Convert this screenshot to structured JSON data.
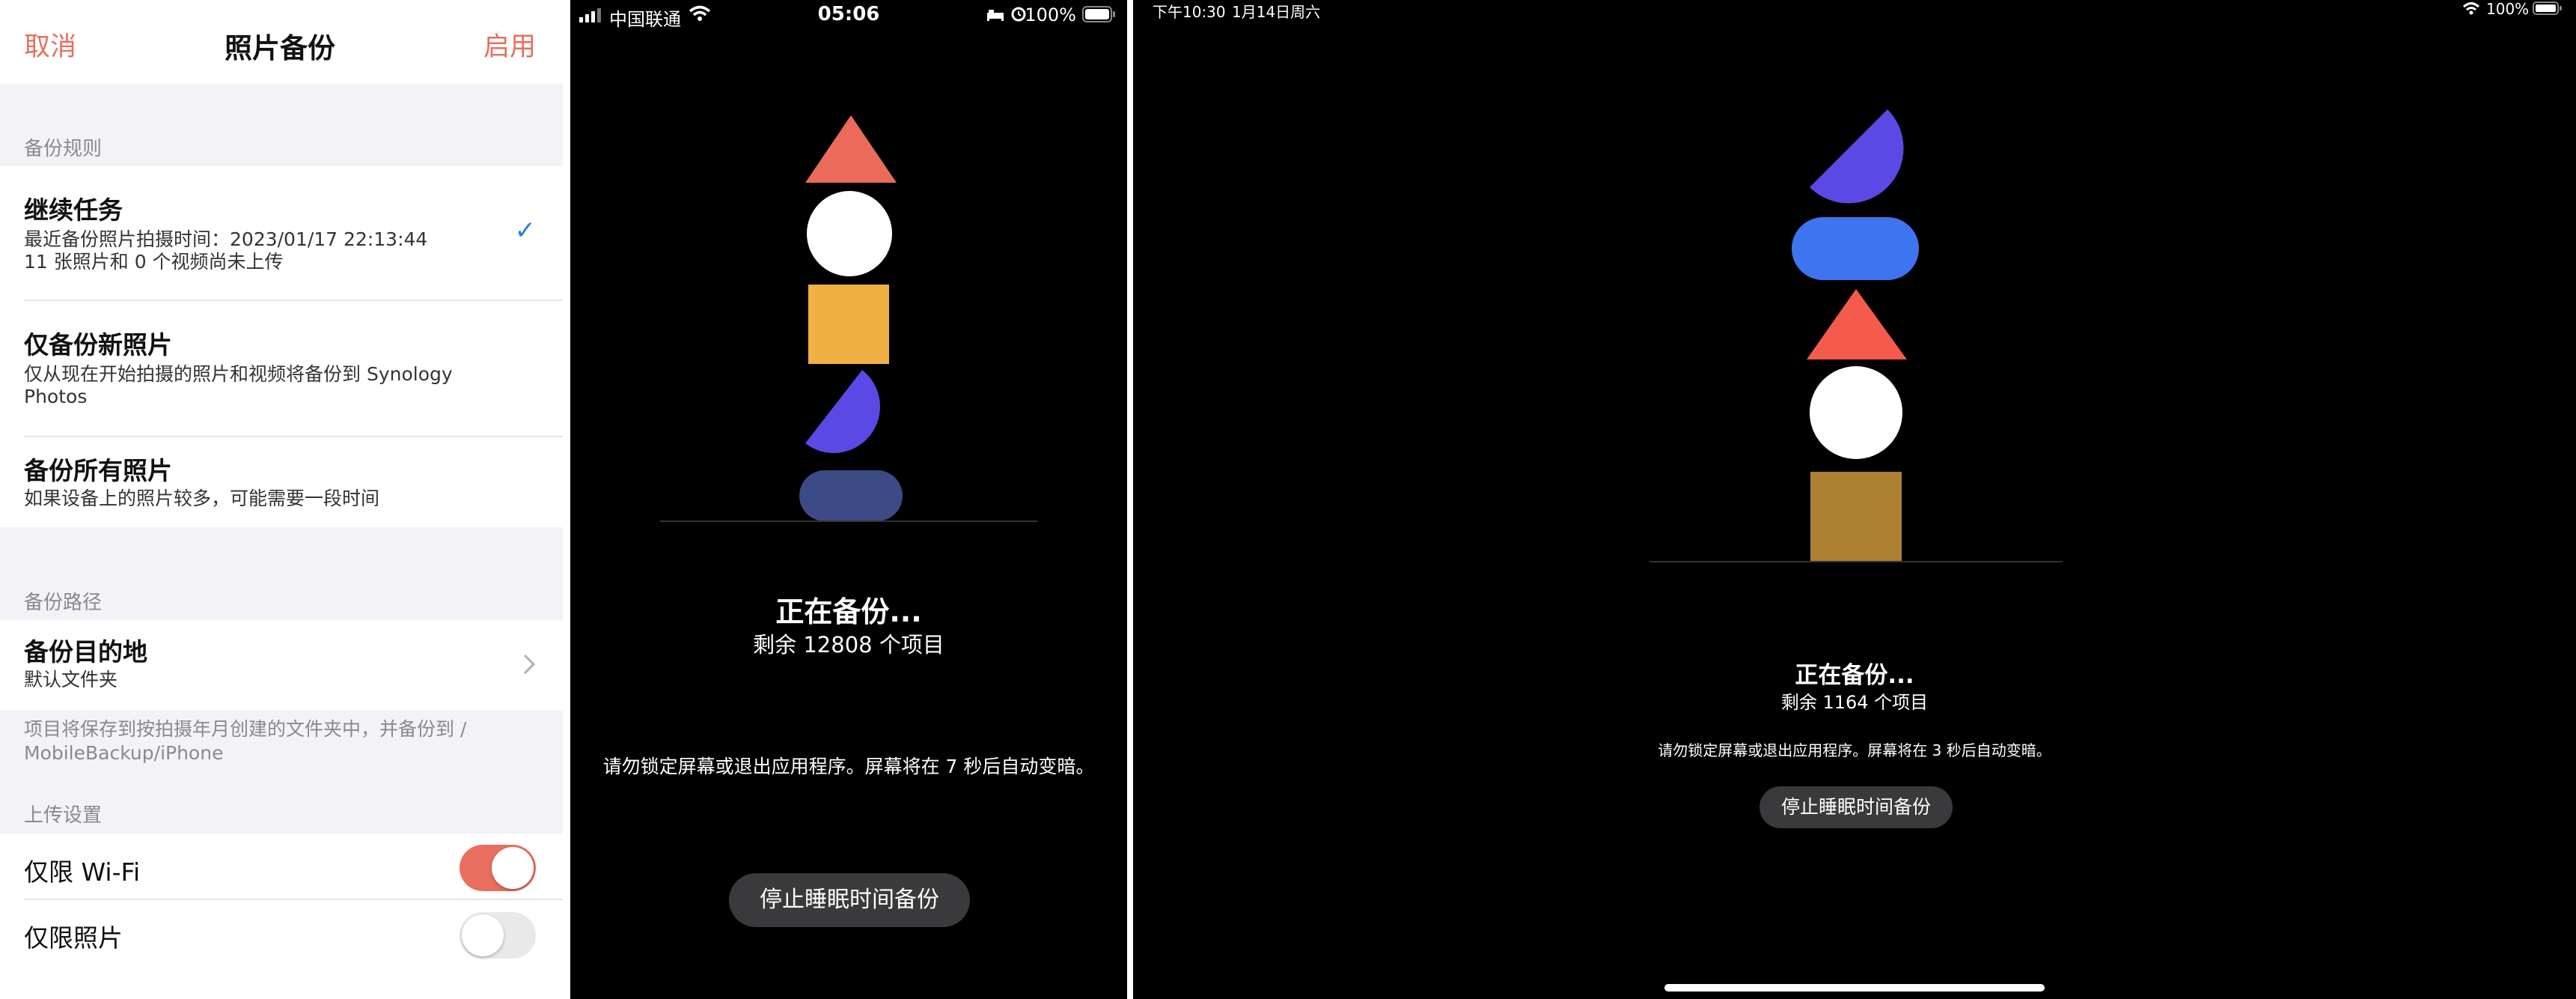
{
  "settings": {
    "cancel": "取消",
    "title": "照片备份",
    "enable": "启用",
    "backup_rules_label": "备份规则",
    "options": [
      {
        "title": "继续任务",
        "line1": "最近备份照片拍摄时间：2023/01/17 22:13:44",
        "line2": "11 张照片和 0 个视频尚未上传",
        "selected": true
      },
      {
        "title": "仅备份新照片",
        "line1": "仅从现在开始拍摄的照片和视频将备份到 Synology",
        "line2": "Photos",
        "selected": false
      },
      {
        "title": "备份所有照片",
        "line1": "如果设备上的照片较多，可能需要一段时间",
        "selected": false
      }
    ],
    "backup_path_label": "备份路径",
    "destination": {
      "title": "备份目的地",
      "value": "默认文件夹"
    },
    "path_note_line1": "项目将保存到按拍摄年月创建的文件夹中，并备份到 /",
    "path_note_line2": "MobileBackup/iPhone",
    "upload_label": "上传设置",
    "wifi_only": {
      "label": "仅限 Wi-Fi",
      "on": true
    },
    "photos_only": {
      "label": "仅限照片",
      "on": false
    },
    "accent_color": "#e86f5e"
  },
  "phone": {
    "status": {
      "carrier": "中国联通",
      "time": "05:06",
      "battery": "100%"
    },
    "backing_up_title": "正在备份...",
    "remaining": "剩余 12808 个项目",
    "warning": "请勿锁定屏幕或退出应用程序。屏幕将在 7 秒后自动变暗。",
    "stop_button": "停止睡眠时间备份",
    "shape_colors": [
      "#ea6b5a",
      "#ffffff",
      "#f1b044",
      "#5b49e6",
      "#3c4b86"
    ]
  },
  "tablet": {
    "status": {
      "time": "下午10:30",
      "date": "1月14日周六",
      "battery": "100%"
    },
    "backing_up_title": "正在备份...",
    "remaining": "剩余 1164 个项目",
    "warning": "请勿锁定屏幕或退出应用程序。屏幕将在 3 秒后自动变暗。",
    "stop_button": "停止睡眠时间备份",
    "shape_colors": [
      "#5b49e6",
      "#3f74f0",
      "#f45b4c",
      "#ffffff",
      "#ae8034"
    ]
  }
}
